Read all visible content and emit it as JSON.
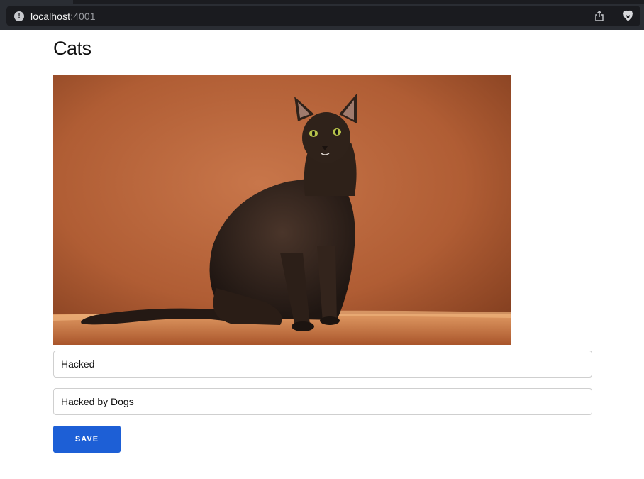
{
  "browser": {
    "url_host": "localhost",
    "url_port": ":4001",
    "info_icon": "info-icon",
    "share_icon": "share-icon",
    "shield_icon": "brave-lion-icon"
  },
  "page": {
    "title": "Cats",
    "image_subject": "cat-photo"
  },
  "form": {
    "title_value": "Hacked",
    "description_value": "Hacked by Dogs",
    "save_label": "SAVE"
  },
  "colors": {
    "accent": "#1d5fd6",
    "browser_bg": "#2a2d33",
    "urlbar_bg": "#1a1b1f"
  }
}
